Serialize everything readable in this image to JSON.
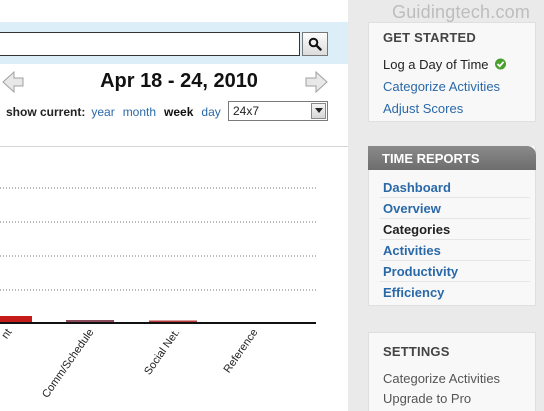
{
  "watermark": "Guidingtech.com",
  "search": {
    "value": "",
    "button_icon": "magnifier-icon"
  },
  "date_nav": {
    "title": "Apr 18 - 24, 2010",
    "prev_icon": "left-arrow-icon",
    "next_icon": "right-arrow-icon"
  },
  "show_current": {
    "label": "show current:",
    "options": [
      "year",
      "month",
      "week",
      "day"
    ],
    "selected": "week"
  },
  "range_select": {
    "value": "24x7"
  },
  "chart_data": {
    "type": "bar",
    "categories": [
      "nt",
      "Comm/Schedule",
      "Social Net.",
      "Reference"
    ],
    "series_color_primary": "#c41a1a",
    "grid": true,
    "values_visible_hint": "small bars near baseline"
  },
  "sidebar": {
    "get_started": {
      "heading": "GET STARTED",
      "items": [
        "Log a Day of Time",
        "Categorize Activities",
        "Adjust Scores"
      ],
      "check_icon": "green-check-icon"
    },
    "time_reports": {
      "heading": "TIME REPORTS",
      "items": [
        "Dashboard",
        "Overview",
        "Categories",
        "Activities",
        "Productivity",
        "Efficiency"
      ],
      "current": "Categories"
    },
    "settings": {
      "heading": "SETTINGS",
      "items": [
        "Categorize Activities",
        "Upgrade to Pro"
      ]
    }
  },
  "colors": {
    "link": "#2a69a8",
    "bar_red": "#c41a1a",
    "panel_bg": "#f8f8f8",
    "header_band": "#dceef8"
  }
}
